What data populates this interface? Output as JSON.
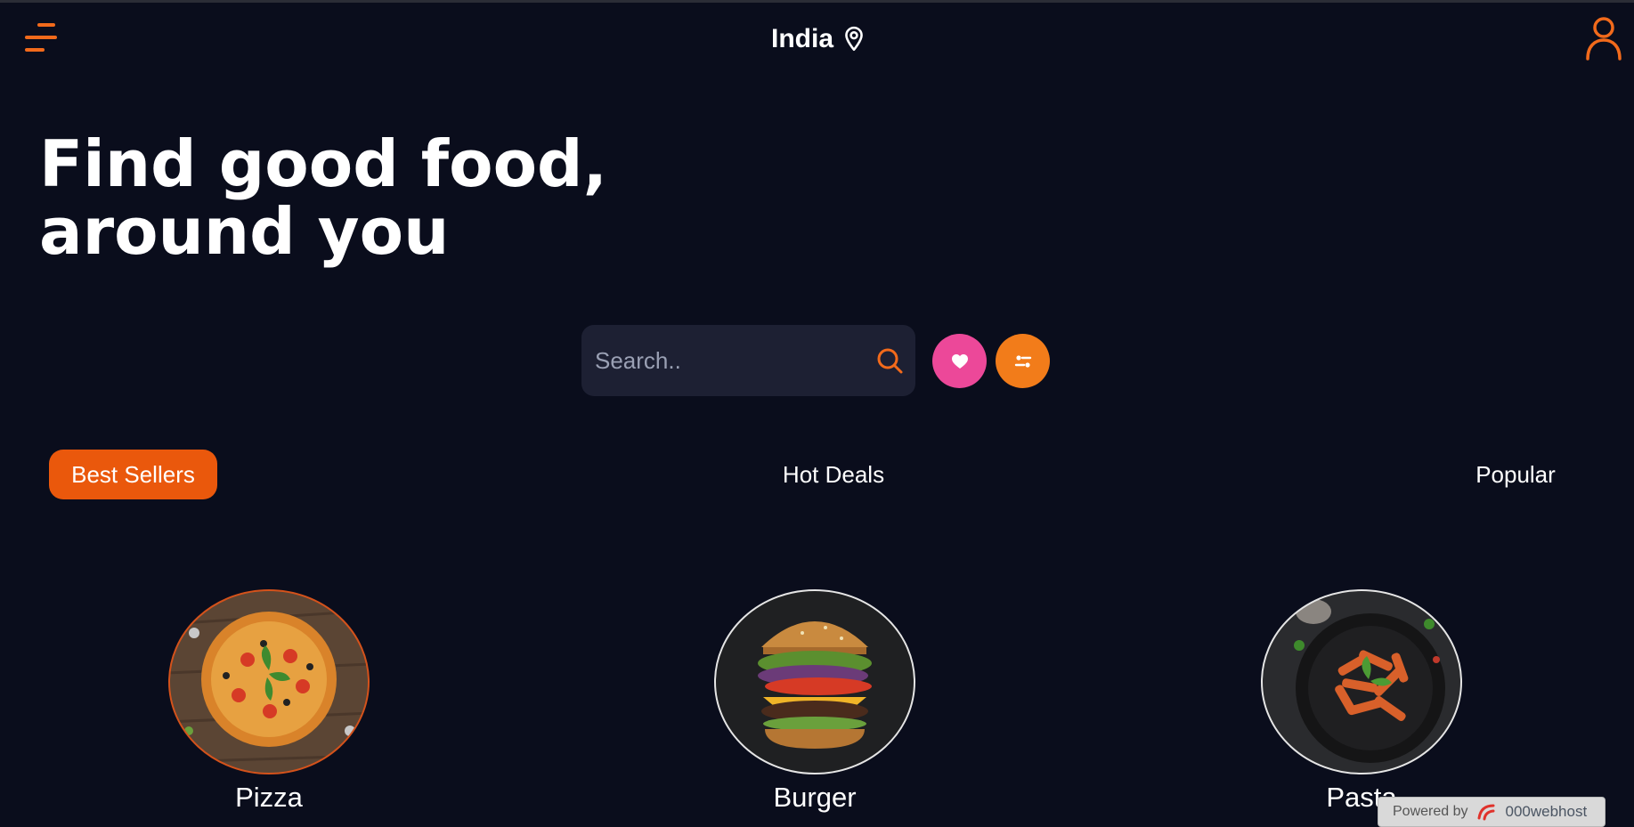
{
  "header": {
    "location": "India",
    "menu_icon": "hamburger-menu-icon",
    "location_icon": "map-pin-icon",
    "user_icon": "user-profile-icon"
  },
  "hero": {
    "title_line1": "Find good food,",
    "title_line2": "around you"
  },
  "search": {
    "placeholder": "Search..",
    "icon": "search-icon"
  },
  "actions": {
    "favorites_icon": "heart-icon",
    "filter_icon": "filter-sliders-icon"
  },
  "tabs": [
    {
      "label": "Best Sellers",
      "active": true
    },
    {
      "label": "Hot Deals",
      "active": false
    },
    {
      "label": "Popular",
      "active": false
    }
  ],
  "foods": [
    {
      "name": "Pizza"
    },
    {
      "name": "Burger"
    },
    {
      "name": "Pasta"
    }
  ],
  "badge": {
    "prefix": "Powered by",
    "brand": "000webhost"
  },
  "colors": {
    "background": "#0a0d1c",
    "accent_orange": "#f26a1b",
    "active_tab": "#ea580c",
    "favorite_pink": "#ec4899",
    "search_bg": "#1d2033"
  }
}
